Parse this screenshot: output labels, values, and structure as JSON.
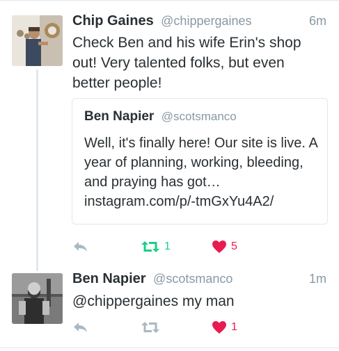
{
  "colors": {
    "retweet_active": "#19cf86",
    "like_active": "#e81c4f",
    "icon_inactive": "#aab8c2",
    "secondary_text": "#8899a6"
  },
  "tweets": [
    {
      "name": "Chip Gaines",
      "handle": "@chippergaines",
      "time": "6m",
      "text": "Check Ben and his wife Erin's shop out! Very talented folks, but even better people!",
      "quote": {
        "name": "Ben Napier",
        "handle": "@scotsmanco",
        "text": "Well, it's finally here! Our site is live. A year of planning, working, bleeding, and praying has got… instagram.com/p/-tmGxYu4A2/"
      },
      "actions": {
        "reply_icon": "reply-icon",
        "retweet_icon": "retweet-icon",
        "retweet_count": "1",
        "retweet_active": true,
        "like_icon": "heart-icon",
        "like_count": "5",
        "like_active": true
      }
    },
    {
      "name": "Ben Napier",
      "handle": "@scotsmanco",
      "time": "1m",
      "text": "@chippergaines my man",
      "actions": {
        "reply_icon": "reply-icon",
        "retweet_icon": "retweet-icon",
        "retweet_count": "",
        "retweet_active": false,
        "like_icon": "heart-icon",
        "like_count": "1",
        "like_active": true
      }
    }
  ]
}
